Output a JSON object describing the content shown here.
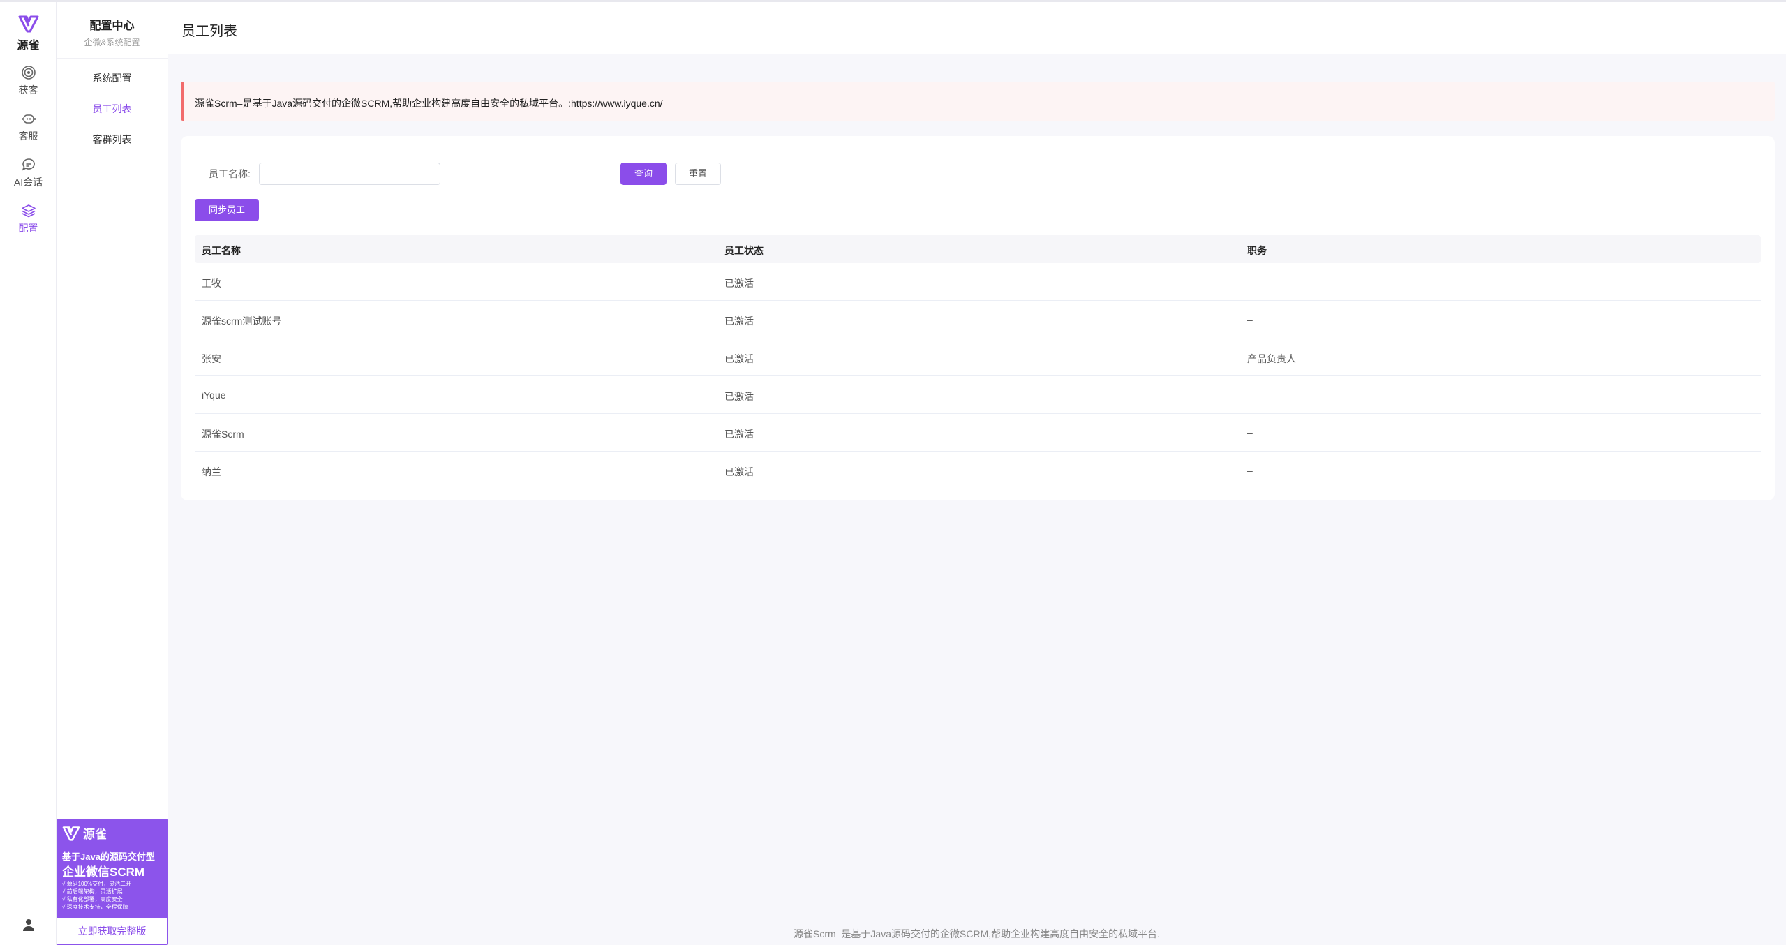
{
  "brand": {
    "name": "源雀",
    "accent": "#8b4dea"
  },
  "rail": {
    "items": [
      {
        "label": "获客",
        "icon": "target-icon"
      },
      {
        "label": "客服",
        "icon": "headset-icon"
      },
      {
        "label": "AI会话",
        "icon": "chat-icon"
      },
      {
        "label": "配置",
        "icon": "layers-icon",
        "active": true
      }
    ]
  },
  "submenu": {
    "title": "配置中心",
    "desc": "企微&系统配置",
    "items": [
      {
        "label": "系统配置"
      },
      {
        "label": "员工列表",
        "active": true
      },
      {
        "label": "客群列表"
      }
    ]
  },
  "promo": {
    "logo": "源雀",
    "line1": "基于Java的源码交付型",
    "line2": "企业微信SCRM",
    "points": [
      "√ 源码100%交付，灵活二开",
      "√ 前后端架构，灵活扩展",
      "√ 私有化部署，高度安全",
      "√ 深度技术支持，全程保障"
    ],
    "button": "立即获取完整版"
  },
  "page": {
    "title": "员工列表"
  },
  "alert": {
    "text": "源雀Scrm–是基于Java源码交付的企微SCRM,帮助企业构建高度自由安全的私域平台。:https://www.iyque.cn/"
  },
  "filter": {
    "label": "员工名称:",
    "input_value": "",
    "input_placeholder": "",
    "query_button": "查询",
    "reset_button": "重置",
    "sync_button": "同步员工"
  },
  "table": {
    "columns": [
      "员工名称",
      "员工状态",
      "职务"
    ],
    "rows": [
      [
        "王牧",
        "已激活",
        "–"
      ],
      [
        "源雀scrm测试账号",
        "已激活",
        "–"
      ],
      [
        "张安",
        "已激活",
        "产品负责人"
      ],
      [
        "iYque",
        "已激活",
        "–"
      ],
      [
        "源雀Scrm",
        "已激活",
        "–"
      ],
      [
        "纳兰",
        "已激活",
        "–"
      ]
    ]
  },
  "footer": {
    "text": "源雀Scrm–是基于Java源码交付的企微SCRM,帮助企业构建高度自由安全的私域平台."
  }
}
